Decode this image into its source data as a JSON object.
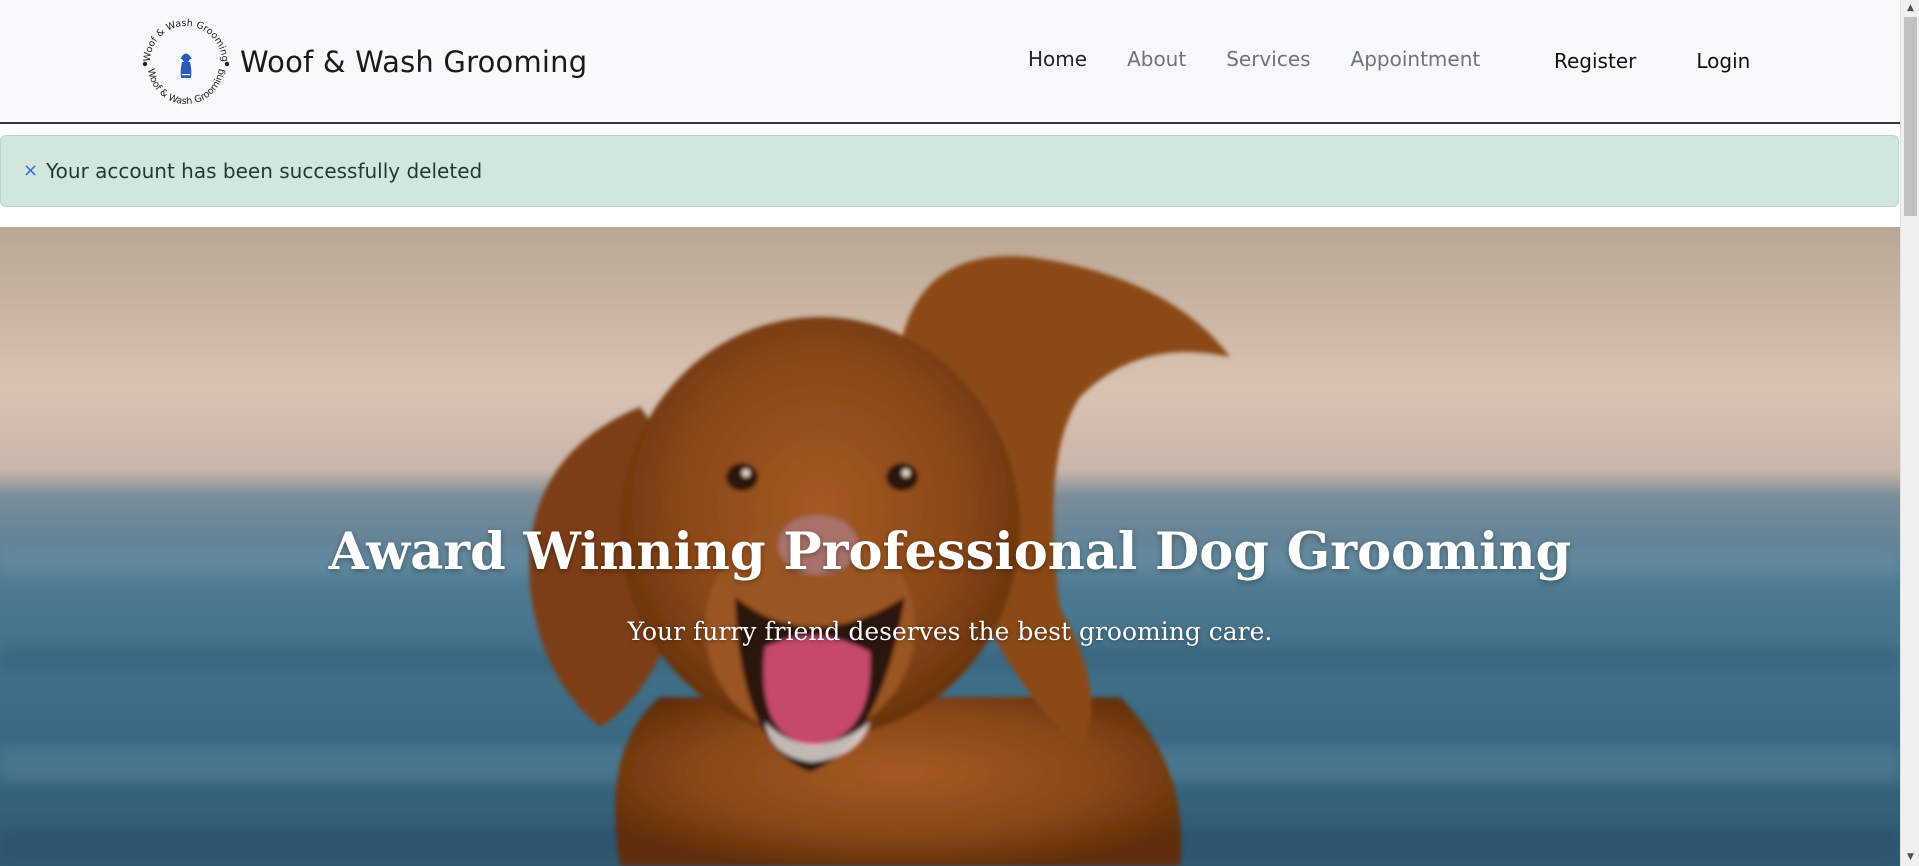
{
  "brand": {
    "name": "Woof & Wash Grooming",
    "logo_ring_text": "Woof & Wash Grooming"
  },
  "nav": {
    "items": [
      {
        "label": "Home",
        "active": true
      },
      {
        "label": "About",
        "active": false
      },
      {
        "label": "Services",
        "active": false
      },
      {
        "label": "Appointment",
        "active": false
      }
    ],
    "auth": [
      {
        "label": "Register"
      },
      {
        "label": "Login"
      }
    ]
  },
  "alert": {
    "close_glyph": "×",
    "message": "Your account has been successfully deleted",
    "color": "#d1e7dd"
  },
  "hero": {
    "title": "Award Winning Professional Dog Grooming",
    "subtitle": "Your furry friend deserves the best grooming care.",
    "image_subject": "brown dog with ears flying in front of ocean"
  },
  "colors": {
    "navbar_bg": "#f8f9fa",
    "nav_active": "#212529",
    "nav_inactive": "#6c757d",
    "alert_bg": "#d1e7dd",
    "hero_text": "#ffffff"
  }
}
